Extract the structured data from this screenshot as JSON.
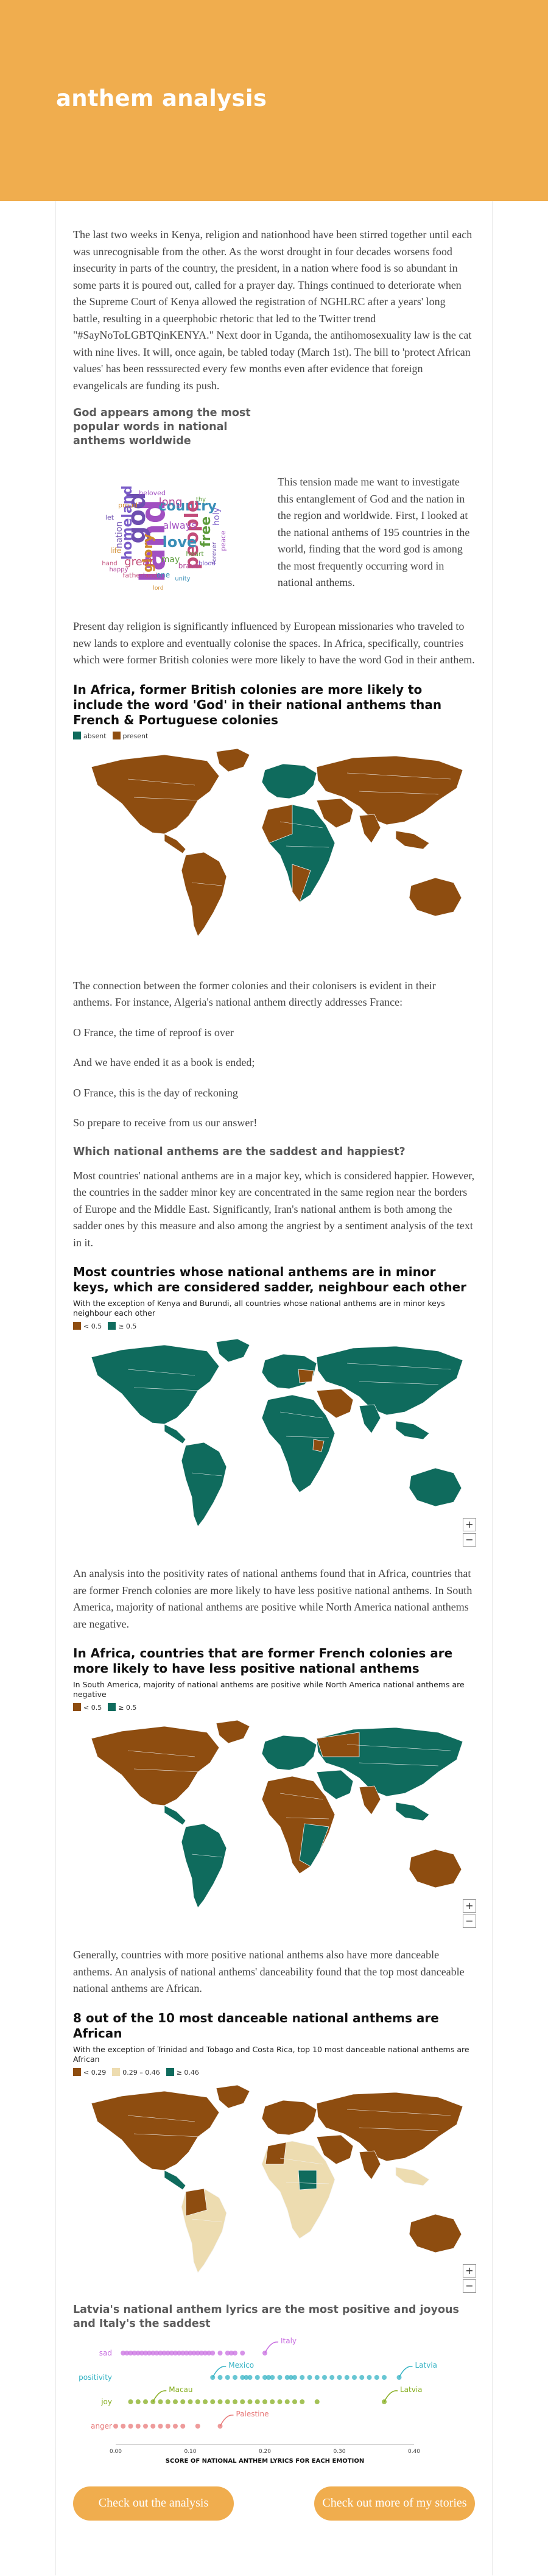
{
  "page": {
    "title": "anthem analysis"
  },
  "intro": "The last two weeks in Kenya, religion and nationhood have been stirred together until each was unrecognisable from the other. As the worst drought in four decades worsens food insecurity in parts of the country, the president, in a nation where food is so abundant in some parts it is poured out, called for a prayer day. Things continued to deteriorate when the Supreme Court of Kenya allowed the registration of NGHLRC after a years' long battle, resulting in a queerphobic rhetoric that led to the Twitter trend \"#SayNoToLGBTQinKENYA.\" Next door in Uganda, the antihomosexuality law is the cat with nine lives. It will, once again, be tabled today (March 1st). The bill to 'protect African values' has been resssurected every few months even after evidence that foreign evangelicals are funding its push.",
  "wordcloud_section": {
    "title": "God appears among the most popular words in national anthems worldwide",
    "words": [
      "land",
      "god",
      "country",
      "people",
      "free",
      "glory",
      "homeland",
      "long",
      "always",
      "nation",
      "love",
      "great",
      "may",
      "life",
      "holy",
      "brave",
      "peace",
      "let",
      "one",
      "fatherland",
      "heart",
      "proud",
      "blood",
      "happy",
      "beloved",
      "forever",
      "unity",
      "hand",
      "thy",
      "lord"
    ],
    "text": "This tension made me want to investigate this entanglement of God and the nation in the region and worldwide. First, I looked at the national anthems of 195 countries in the world, finding that the word god is among the most frequently occurring word in national anthems."
  },
  "p_religion": "Present day religion is significantly influenced by European missionaries who traveled to new lands to explore and eventually colonise the spaces. In Africa, specifically, countries which were former British colonies were more likely to have the word God in their anthem.",
  "map1": {
    "title": "In Africa, former British colonies are more likely to include the word 'God' in their national anthems than French & Portuguese colonies",
    "legend": [
      {
        "label": "absent",
        "color": "#0f6b5d"
      },
      {
        "label": "present",
        "color": "#8e4d10"
      }
    ]
  },
  "p_colonies": "The connection between the former colonies and their colonisers is evident in their anthems. For instance, Algeria's national anthem directly addresses France:",
  "quote": [
    "O France, the time of reproof is over",
    "And we have ended it as a book is ended;",
    "O France, this is the day of reckoning",
    "So prepare to receive from us our answer!"
  ],
  "sad_section": {
    "heading": "Which national anthems are the saddest and happiest?",
    "text": "Most countries' national anthems are in a major key, which is considered happier. However, the countries in the sadder minor key are concentrated in the same region near the borders of Europe and the Middle East. Significantly, Iran's national anthem is both among the sadder ones by this measure and also among the angriest by a sentiment analysis of the text in it."
  },
  "map2": {
    "title": "Most countries whose national anthems are in minor keys, which are considered sadder, neighbour each other",
    "subtitle": "With the exception of Kenya and Burundi, all countries whose national anthems are in minor keys neighbour each other",
    "legend": [
      {
        "label": "< 0.5",
        "color": "#8e4d10"
      },
      {
        "label": "≥ 0.5",
        "color": "#0f6b5d"
      }
    ]
  },
  "p_positivity": "An analysis into the positivity rates of national anthems found that in Africa, countries that are former French colonies are more likely to have less positive national anthems. In South America, majority of national anthems are positive while North America national anthems are negative.",
  "map3": {
    "title": "In Africa, countries that are former French colonies are more likely to have less positive national anthems",
    "subtitle": "In South America, majority of national anthems are positive while North America national anthems are negative",
    "legend": [
      {
        "label": "< 0.5",
        "color": "#8e4d10"
      },
      {
        "label": "≥ 0.5",
        "color": "#0f6b5d"
      }
    ]
  },
  "p_dance": "Generally, countries with more positive national anthems also have more danceable anthems. An analysis of national anthems' danceability found that the top most danceable national anthems are African.",
  "map4": {
    "title": "8 out of the 10 most danceable national anthems are African",
    "subtitle": "With the exception of Trinidad and Tobago and Costa Rica, top 10 most danceable  national anthems are African",
    "legend": [
      {
        "label": "< 0.29",
        "color": "#8e4d10"
      },
      {
        "label": "0.29 – 0.46",
        "color": "#eddcb0"
      },
      {
        "label": "≥ 0.46",
        "color": "#0f6b5d"
      }
    ]
  },
  "emotion_chart": {
    "title": "Latvia's national anthem lyrics are the most positive and joyous and Italy's the saddest",
    "xlabel": "SCORE OF NATIONAL ANTHEM LYRICS FOR EACH EMOTION",
    "ticks": [
      "0.00",
      "0.10",
      "0.20",
      "0.30",
      "0.40"
    ],
    "xlim": [
      0,
      0.4
    ]
  },
  "chart_data": {
    "type": "scatter",
    "title": "Latvia's national anthem lyrics are the most positive and joyous and Italy's the saddest",
    "xlabel": "SCORE OF NATIONAL ANTHEM LYRICS FOR EACH EMOTION",
    "categories": [
      "sad",
      "positivity",
      "joy",
      "anger"
    ],
    "series": [
      {
        "name": "sad",
        "color": "#c86ee0",
        "values": [
          0.01,
          0.015,
          0.02,
          0.025,
          0.03,
          0.035,
          0.04,
          0.045,
          0.05,
          0.055,
          0.06,
          0.065,
          0.07,
          0.075,
          0.08,
          0.085,
          0.09,
          0.095,
          0.1,
          0.105,
          0.11,
          0.115,
          0.12,
          0.125,
          0.13,
          0.14,
          0.15,
          0.155,
          0.16,
          0.17,
          0.2
        ],
        "labels": [
          {
            "text": "Italy",
            "x": 0.2
          }
        ]
      },
      {
        "name": "positivity",
        "color": "#36b3c4",
        "values": [
          0.13,
          0.14,
          0.15,
          0.16,
          0.17,
          0.175,
          0.18,
          0.19,
          0.2,
          0.205,
          0.21,
          0.22,
          0.23,
          0.235,
          0.24,
          0.25,
          0.26,
          0.27,
          0.28,
          0.29,
          0.3,
          0.31,
          0.32,
          0.33,
          0.34,
          0.35,
          0.36,
          0.38
        ],
        "labels": [
          {
            "text": "Mexico",
            "x": 0.13
          },
          {
            "text": "Latvia",
            "x": 0.38
          }
        ]
      },
      {
        "name": "joy",
        "color": "#86ad1f",
        "values": [
          0.02,
          0.03,
          0.04,
          0.05,
          0.06,
          0.07,
          0.08,
          0.09,
          0.1,
          0.11,
          0.12,
          0.13,
          0.14,
          0.15,
          0.16,
          0.17,
          0.18,
          0.19,
          0.2,
          0.21,
          0.22,
          0.23,
          0.24,
          0.25,
          0.27,
          0.36
        ],
        "labels": [
          {
            "text": "Macau",
            "x": 0.05
          },
          {
            "text": "Latvia",
            "x": 0.36
          }
        ]
      },
      {
        "name": "anger",
        "color": "#e87a7a",
        "values": [
          0.0,
          0.01,
          0.02,
          0.03,
          0.04,
          0.05,
          0.06,
          0.07,
          0.08,
          0.09,
          0.11,
          0.14
        ],
        "labels": [
          {
            "text": "Palestine",
            "x": 0.14
          }
        ]
      }
    ],
    "xlim": [
      0,
      0.4
    ]
  },
  "buttons": {
    "analysis": "Check out the analysis",
    "stories": "Check out more of my stories"
  },
  "map_controls": {
    "zoom_in": "+",
    "zoom_out": "−"
  }
}
